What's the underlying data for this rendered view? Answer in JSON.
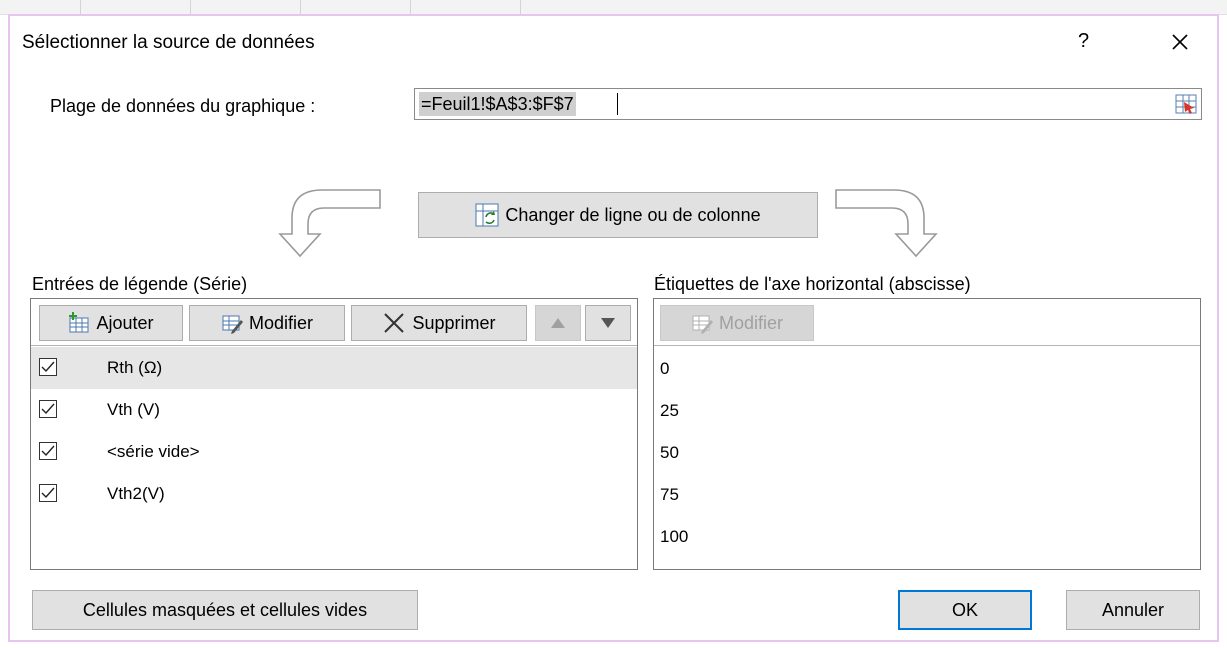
{
  "dialog": {
    "title": "Sélectionner la source de données",
    "help_label": "?",
    "range_label": "Plage de données du graphique :",
    "range_value": "=Feuil1!$A$3:$F$7",
    "switch_label": "Changer de ligne ou de colonne"
  },
  "legend": {
    "label": "Entrées de légende (Série)",
    "add_label": "Ajouter",
    "edit_label": "Modifier",
    "delete_label": "Supprimer",
    "series": [
      {
        "name": "Rth (Ω)",
        "checked": true
      },
      {
        "name": "Vth (V)",
        "checked": true
      },
      {
        "name": "<série vide>",
        "checked": true
      },
      {
        "name": "Vth2(V)",
        "checked": true
      }
    ]
  },
  "axis": {
    "label": "Étiquettes de l'axe horizontal (abscisse)",
    "edit_label": "Modifier",
    "values": [
      "0",
      "25",
      "50",
      "75",
      "100"
    ]
  },
  "footer": {
    "hidden_cells_label": "Cellules masquées et cellules vides",
    "ok_label": "OK",
    "cancel_label": "Annuler"
  },
  "colors": {
    "ok_border": "#0078d7",
    "selected_row": "#e6e6e6",
    "button_face": "#e1e1e1"
  }
}
